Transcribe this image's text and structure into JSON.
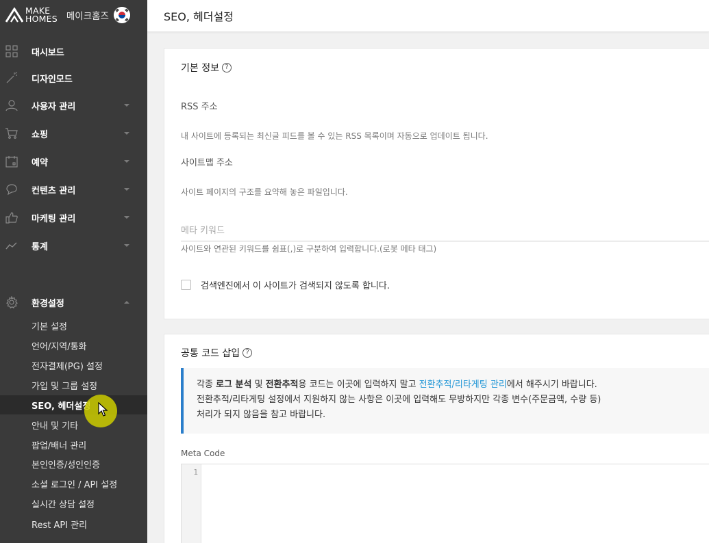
{
  "brand": {
    "logo_line1": "MAKE",
    "logo_line2": "HOMES",
    "site_name": "메이크홈즈"
  },
  "page": {
    "title": "SEO, 헤더설정"
  },
  "sidebar": {
    "menu": [
      {
        "label": "대시보드",
        "icon": "dashboard-grid-icon",
        "has_caret": false
      },
      {
        "label": "디자인모드",
        "icon": "magic-wand-icon",
        "has_caret": false
      },
      {
        "label": "사용자 관리",
        "icon": "user-icon",
        "has_caret": true
      },
      {
        "label": "쇼핑",
        "icon": "cart-icon",
        "has_caret": true
      },
      {
        "label": "예약",
        "icon": "calendar-icon",
        "has_caret": true
      },
      {
        "label": "컨텐츠 관리",
        "icon": "chat-icon",
        "has_caret": true
      },
      {
        "label": "마케팅 관리",
        "icon": "thumbs-up-icon",
        "has_caret": true
      },
      {
        "label": "통계",
        "icon": "line-chart-icon",
        "has_caret": true
      }
    ],
    "settings": {
      "label": "환경설정",
      "icon": "gear-icon",
      "sub_items": [
        "기본 설정",
        "언어/지역/통화",
        "전자결제(PG) 설정",
        "가입 및 그룹 설정",
        "SEO, 헤더설정",
        "안내 및 기타",
        "팝업/배너 관리",
        "본인인증/성인인증",
        "소셜 로그인 / API 설정",
        "실시간 상담 설정",
        "Rest API 관리"
      ],
      "active_index": 4
    }
  },
  "basic_info": {
    "title": "기본 정보",
    "rss_label": "RSS 주소",
    "rss_help": "내 사이트에 등록되는 최신글 피드를 볼 수 있는 RSS 목록이며 자동으로 업데이트 됩니다.",
    "sitemap_label": "사이트맵 주소",
    "sitemap_help": "사이트 페이지의 구조를 요약해 놓은 파일입니다.",
    "meta_keyword_placeholder": "메타 키워드",
    "meta_keyword_value": "",
    "meta_keyword_help": "사이트와 연관된 키워드를 쉼표(,)로 구분하여 입력합니다.(로봇 메타 태그)",
    "hide_search_label": "검색엔진에서 이 사이트가 검색되지 않도록 합니다.",
    "hide_search_checked": false
  },
  "common_code": {
    "title": "공통 코드 삽입",
    "notice": {
      "p1": "각종 ",
      "b1": "로그 분석",
      "p2": " 및 ",
      "b2": "전환추적",
      "p3": "용 코드는 이곳에 입력하지 말고 ",
      "link": "전환추적/리타게팅 관리",
      "p4": "에서 해주시기 바랍니다.",
      "line2": "전환추적/리타게팅 설정에서 지원하지 않는 사항은 이곳에 입력해도 무방하지만 각종 변수(주문금액, 수량 등)",
      "line3": "처리가 되지 않음을 참고 바랍니다."
    },
    "code_label": "Meta Code",
    "line_number": "1"
  },
  "colors": {
    "sidebar_bg": "#3a3a3a",
    "active_bg": "#2b2b2b",
    "accent": "#2a7ecb",
    "link": "#2196d6",
    "cursor_halo": "#cdcd00"
  }
}
